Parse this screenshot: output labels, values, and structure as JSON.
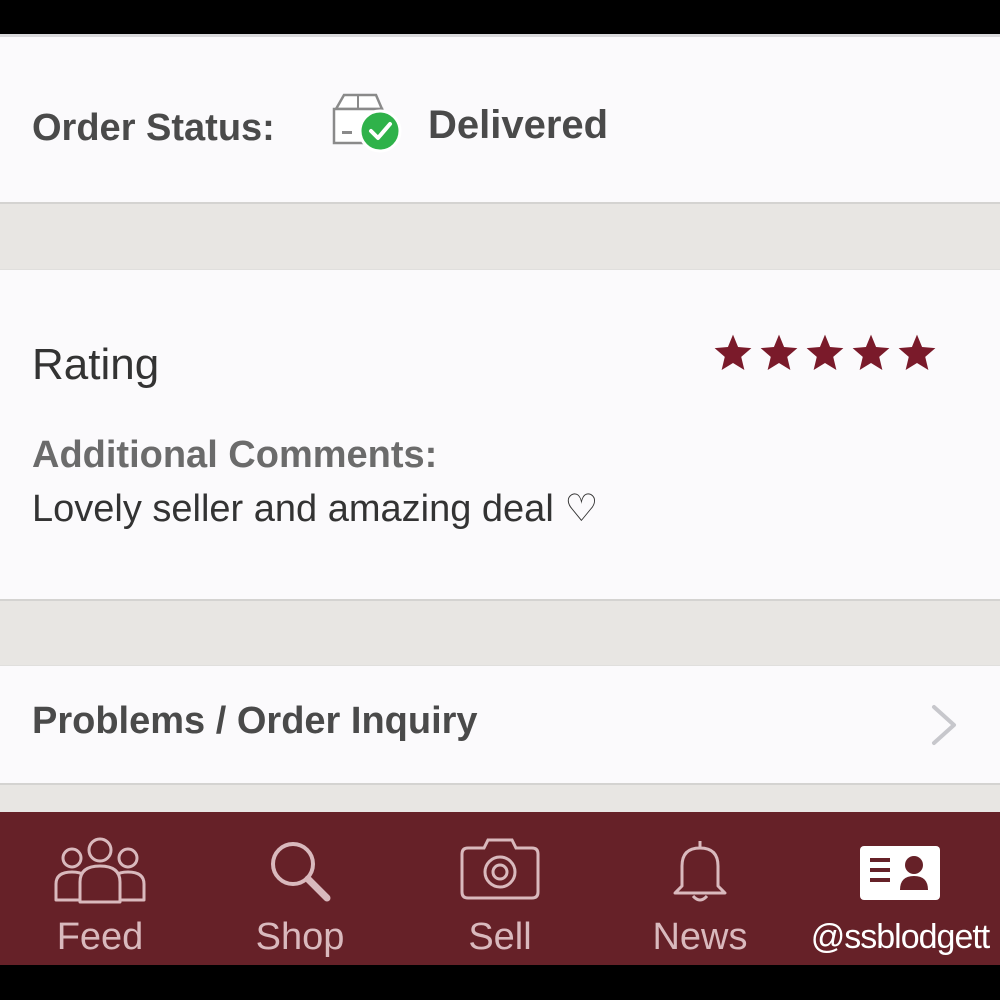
{
  "order": {
    "status_label": "Order Status:",
    "status_value": "Delivered",
    "status_icon": "box-delivered-icon"
  },
  "rating": {
    "label": "Rating",
    "stars": 5,
    "max_stars": 5,
    "star_color": "#7a1a2a",
    "comments_label": "Additional Comments:",
    "comments_text": "Lovely seller and amazing deal ♡"
  },
  "inquiry": {
    "label": "Problems / Order Inquiry",
    "icon": "chevron-right-icon"
  },
  "tabbar": {
    "background": "#662128",
    "items": [
      {
        "label": "Feed",
        "icon": "people-icon"
      },
      {
        "label": "Shop",
        "icon": "search-icon"
      },
      {
        "label": "Sell",
        "icon": "camera-icon"
      },
      {
        "label": "News",
        "icon": "bell-icon"
      },
      {
        "label": "@ssblodgett",
        "icon": "profile-card-icon",
        "active": true
      }
    ]
  }
}
